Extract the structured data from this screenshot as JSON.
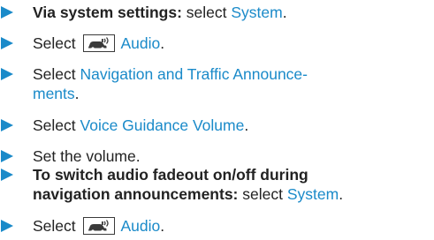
{
  "steps": [
    {
      "bold": "Via system settings:",
      "text": " select ",
      "link": "System",
      "end": "."
    },
    {
      "text": "Select ",
      "icon": "car-audio-icon",
      "link": "Audio",
      "end": "."
    },
    {
      "text": "Select ",
      "link_line1": "Navigation and Traffic Announce-",
      "link_line2": "ments",
      "end": "."
    },
    {
      "text": "Select ",
      "link": "Voice Guidance Volume",
      "end": "."
    },
    {
      "text": "Set the volume."
    },
    {
      "bold_line1": "To switch audio fadeout on/off during",
      "bold_line2": "navigation announcements:",
      "text": " select ",
      "link": "System",
      "end": "."
    },
    {
      "text": "Select ",
      "icon": "car-audio-icon",
      "link": "Audio",
      "end": "."
    }
  ],
  "colors": {
    "accent": "#1a8ac9",
    "text": "#222222"
  }
}
